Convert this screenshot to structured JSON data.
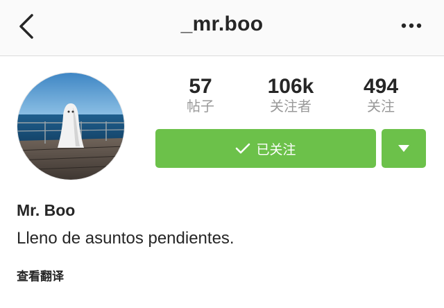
{
  "header": {
    "title": "_mr.boo",
    "back_icon": "chevron-left-icon",
    "more_icon": "more-horizontal-icon"
  },
  "profile": {
    "display_name": "Mr. Boo",
    "bio": "Lleno de asuntos pendientes.",
    "translate_label": "查看翻译"
  },
  "stats": {
    "posts": {
      "value": "57",
      "label": "帖子"
    },
    "followers": {
      "value": "106k",
      "label": "关注者"
    },
    "following": {
      "value": "494",
      "label": "关注"
    }
  },
  "actions": {
    "following_label": "已关注",
    "following_icon": "check-icon",
    "dropdown_icon": "caret-down-icon"
  },
  "colors": {
    "accent_green": "#6cc14a",
    "muted_text": "#999999",
    "primary_text": "#262626"
  }
}
